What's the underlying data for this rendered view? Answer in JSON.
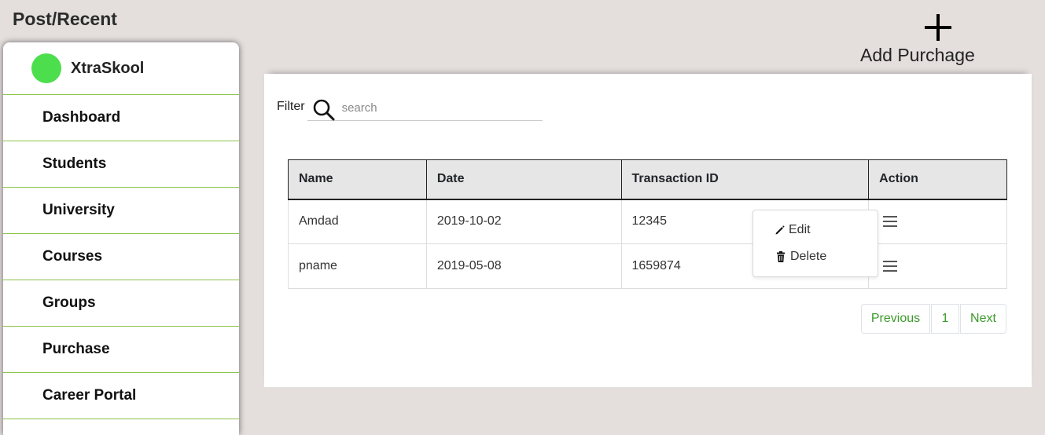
{
  "page": {
    "title": "Post/Recent"
  },
  "sidebar": {
    "brand": "XtraSkool",
    "items": [
      {
        "label": "Dashboard"
      },
      {
        "label": "Students"
      },
      {
        "label": "University"
      },
      {
        "label": "Courses"
      },
      {
        "label": "Groups"
      },
      {
        "label": "Purchase"
      },
      {
        "label": "Career Portal"
      }
    ]
  },
  "add_button": {
    "label": "Add Purchage",
    "icon": "plus-icon"
  },
  "filter": {
    "label": "Filter",
    "placeholder": "search",
    "icon": "search-icon"
  },
  "table": {
    "headers": [
      "Name",
      "Date",
      "Transaction ID",
      "Action"
    ],
    "rows": [
      {
        "name": "Amdad",
        "date": "2019-10-02",
        "transaction_id": "12345"
      },
      {
        "name": "pname",
        "date": "2019-05-08",
        "transaction_id": "1659874"
      }
    ]
  },
  "action_menu": {
    "edit": "Edit",
    "delete": "Delete"
  },
  "pagination": {
    "previous": "Previous",
    "page": "1",
    "next": "Next"
  },
  "colors": {
    "accent_green": "#3a9a2a",
    "divider_green": "#8bc34a",
    "brand_dot": "#4cde4c",
    "background": "#e4dedd"
  }
}
